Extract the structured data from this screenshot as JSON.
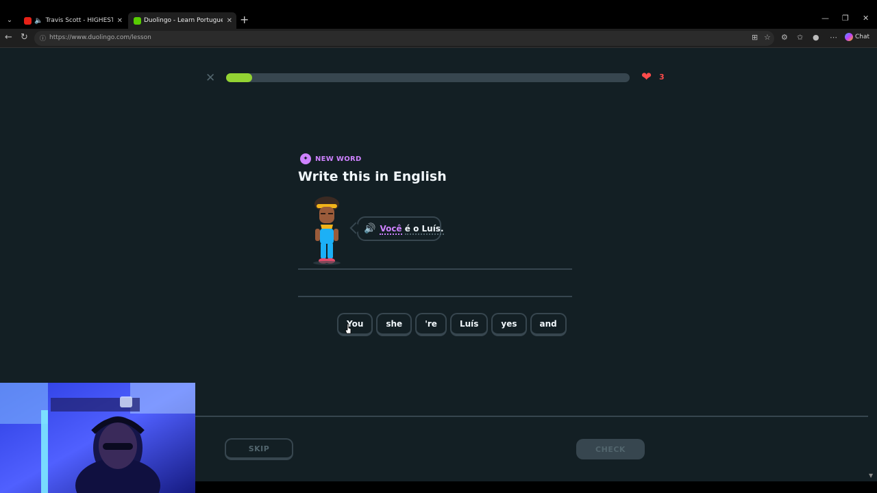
{
  "browser": {
    "tabs": [
      {
        "title": "Travis Scott - HIGHEST IN THE",
        "favicon": "youtube-icon",
        "audio": true,
        "active": false
      },
      {
        "title": "Duolingo - Learn Portuguese with",
        "favicon": "duolingo-icon",
        "audio": false,
        "active": true
      }
    ],
    "url": "https://www.duolingo.com/lesson",
    "chat_label": "Chat"
  },
  "lesson": {
    "progress": 0.065,
    "hearts": "3",
    "badge": "NEW WORD",
    "prompt_title": "Write this in English",
    "sentence": {
      "new_word": "Você",
      "rest": "é o Luís."
    },
    "word_bank": [
      "You",
      "she",
      "'re",
      "Luís",
      "yes",
      "and"
    ],
    "skip_label": "SKIP",
    "check_label": "CHECK"
  },
  "colors": {
    "background": "#131f24",
    "progress_fill": "#93d333",
    "accent_purple": "#ce82ff",
    "heart": "#ff4b4b",
    "border": "#37464f"
  }
}
